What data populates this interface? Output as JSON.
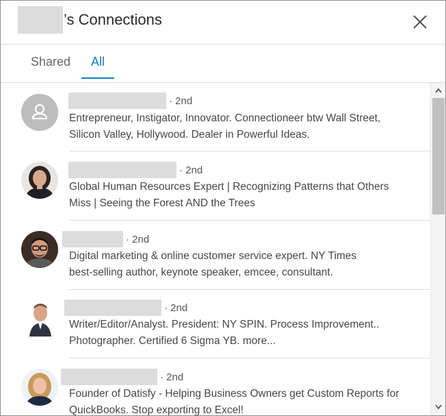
{
  "dialog": {
    "title_suffix": "’s Connections",
    "close_icon": "close-icon"
  },
  "tabs": [
    {
      "label": "Shared",
      "active": false
    },
    {
      "label": "All",
      "active": true
    }
  ],
  "connections": [
    {
      "degree": "· 2nd",
      "headline_line1": "Entrepreneur, Instigator, Innovator. Connectioneer btw Wall Street,",
      "headline_line2": "Silicon Valley, Hollywood. Dealer in Powerful Ideas.",
      "avatar": "default-person-icon"
    },
    {
      "degree": "· 2nd",
      "headline_line1": "Global Human Resources Expert | Recognizing Patterns that Others",
      "headline_line2": "Miss | Seeing the Forest AND the Trees",
      "avatar": "profile-photo"
    },
    {
      "degree": "· 2nd",
      "headline_line1": "Digital marketing & online customer service expert. NY Times",
      "headline_line2": "best-selling author, keynote speaker, emcee, consultant.",
      "avatar": "profile-photo"
    },
    {
      "degree": "· 2nd",
      "headline_line1": "Writer/Editor/Analyst. President: NY SPIN. Process Improvement..",
      "headline_line2": "Photographer. Certified 6 Sigma YB. more...",
      "avatar": "profile-photo"
    },
    {
      "degree": "· 2nd",
      "headline_line1": "Founder of Datisfy - Helping Business Owners get Custom Reports for",
      "headline_line2": "QuickBooks. Stop exporting to Excel!",
      "avatar": "profile-photo"
    }
  ],
  "colors": {
    "accent": "#0b7fc7",
    "redaction": "#dcdcdc",
    "divider": "#dcdcdc"
  }
}
